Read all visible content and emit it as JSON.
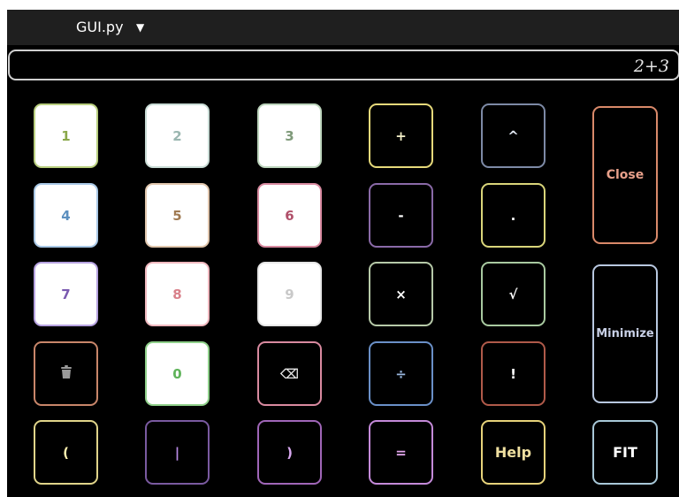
{
  "titlebar": {
    "title": "GUI.py",
    "dropdown_icon": "caret-down-icon"
  },
  "display": {
    "value": "2+3"
  },
  "keys": {
    "one": {
      "label": "1",
      "text_color": "#8aa84a",
      "border_color": "#b9cf7f"
    },
    "two": {
      "label": "2",
      "text_color": "#9ab6b0",
      "border_color": "#c9dcd6"
    },
    "three": {
      "label": "3",
      "text_color": "#7f9a7a",
      "border_color": "#bdd5bd"
    },
    "plus": {
      "label": "+",
      "text_color": "#f4f0c8",
      "border_color": "#e6d97a"
    },
    "power": {
      "label": "^",
      "text_color": "#dfe6f0",
      "border_color": "#7d8aa6"
    },
    "close": {
      "label": "Close",
      "text_color": "#e8a08a",
      "border_color": "#d9896a"
    },
    "four": {
      "label": "4",
      "text_color": "#5b8fbf",
      "border_color": "#a9c8e6"
    },
    "five": {
      "label": "5",
      "text_color": "#a07a52",
      "border_color": "#e0c6ad"
    },
    "six": {
      "label": "6",
      "text_color": "#b0506a",
      "border_color": "#d88aa0"
    },
    "minus": {
      "label": "-",
      "text_color": "#ffffff",
      "border_color": "#8a6aa8"
    },
    "dot": {
      "label": ".",
      "text_color": "#ffffff",
      "border_color": "#d9d57a"
    },
    "seven": {
      "label": "7",
      "text_color": "#7a5ab0",
      "border_color": "#b6a2e0"
    },
    "eight": {
      "label": "8",
      "text_color": "#d9808a",
      "border_color": "#f0b8bf"
    },
    "nine": {
      "label": "9",
      "text_color": "#c9c9c9",
      "border_color": "#e6e6e6"
    },
    "multiply": {
      "label": "×",
      "text_color": "#ffffff",
      "border_color": "#b6c9a8"
    },
    "sqrt": {
      "label": "√",
      "text_color": "#ffffff",
      "border_color": "#a8c9a0"
    },
    "minimize": {
      "label": "Minimize",
      "text_color": "#c8d0e6",
      "border_color": "#b8c8e0"
    },
    "clear": {
      "label": "",
      "icon": "trash-icon",
      "text_color": "#9a9a9a",
      "border_color": "#c9866a"
    },
    "zero": {
      "label": "0",
      "text_color": "#5fb35a",
      "border_color": "#8fd08a"
    },
    "backspace": {
      "label": "⌫",
      "icon": "backspace-icon",
      "text_color": "#e6e6e6",
      "border_color": "#d98aa0"
    },
    "divide": {
      "label": "÷",
      "text_color": "#9ab8e0",
      "border_color": "#6a90c8"
    },
    "factorial": {
      "label": "!",
      "text_color": "#ffffff",
      "border_color": "#b05a4a"
    },
    "lparen": {
      "label": "(",
      "text_color": "#fff2b0",
      "border_color": "#e0d48a"
    },
    "pipe": {
      "label": "|",
      "text_color": "#b88ae6",
      "border_color": "#7a5aa0"
    },
    "rparen": {
      "label": ")",
      "text_color": "#d8a8f0",
      "border_color": "#a066b8"
    },
    "equals": {
      "label": "=",
      "text_color": "#e6a8f0",
      "border_color": "#c48ad9"
    },
    "help": {
      "label": "Help",
      "text_color": "#f0e0a0",
      "border_color": "#e6d27a"
    },
    "fit": {
      "label": "FIT",
      "text_color": "#ffffff",
      "border_color": "#a8c8d8"
    }
  }
}
